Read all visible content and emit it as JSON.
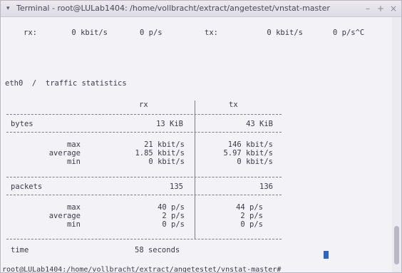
{
  "window": {
    "menu_caret": "▾",
    "title": "Terminal - root@LULab1404: /home/vollbracht/extract/angetestet/vnstat-master",
    "minimize": "–",
    "maximize": "+",
    "close": "×"
  },
  "live_line": {
    "rx_label": "rx:",
    "rx_rate": "0 kbit/s",
    "rx_packets": "0 p/s",
    "tx_label": "tx:",
    "tx_rate": "0 kbit/s",
    "tx_packets": "0 p/s^C"
  },
  "stats_heading": "eth0  /  traffic statistics",
  "columns": {
    "rx": "rx",
    "tx": "tx"
  },
  "bytes": {
    "label": "bytes",
    "rx": "13 KiB",
    "tx": "43 KiB"
  },
  "rate_stats": {
    "max": {
      "label": "max",
      "rx": "21 kbit/s",
      "tx": "146 kbit/s"
    },
    "average": {
      "label": "average",
      "rx": "1.85 kbit/s",
      "tx": "5.97 kbit/s"
    },
    "min": {
      "label": "min",
      "rx": "0 kbit/s",
      "tx": "0 kbit/s"
    }
  },
  "packets": {
    "label": "packets",
    "rx": "135",
    "tx": "136"
  },
  "packet_stats": {
    "max": {
      "label": "max",
      "rx": "40 p/s",
      "tx": "44 p/s"
    },
    "average": {
      "label": "average",
      "rx": "2 p/s",
      "tx": "2 p/s"
    },
    "min": {
      "label": "min",
      "rx": "0 p/s",
      "tx": "0 p/s"
    }
  },
  "time": {
    "label": "time",
    "value": "58 seconds"
  },
  "prompt": "root@LULab1404:/home/vollbracht/extract/angetestet/vnstat-master#",
  "colors": {
    "terminal_bg": "#f3f2f6",
    "text": "#3c3a48",
    "cursor": "#2a66c8"
  }
}
